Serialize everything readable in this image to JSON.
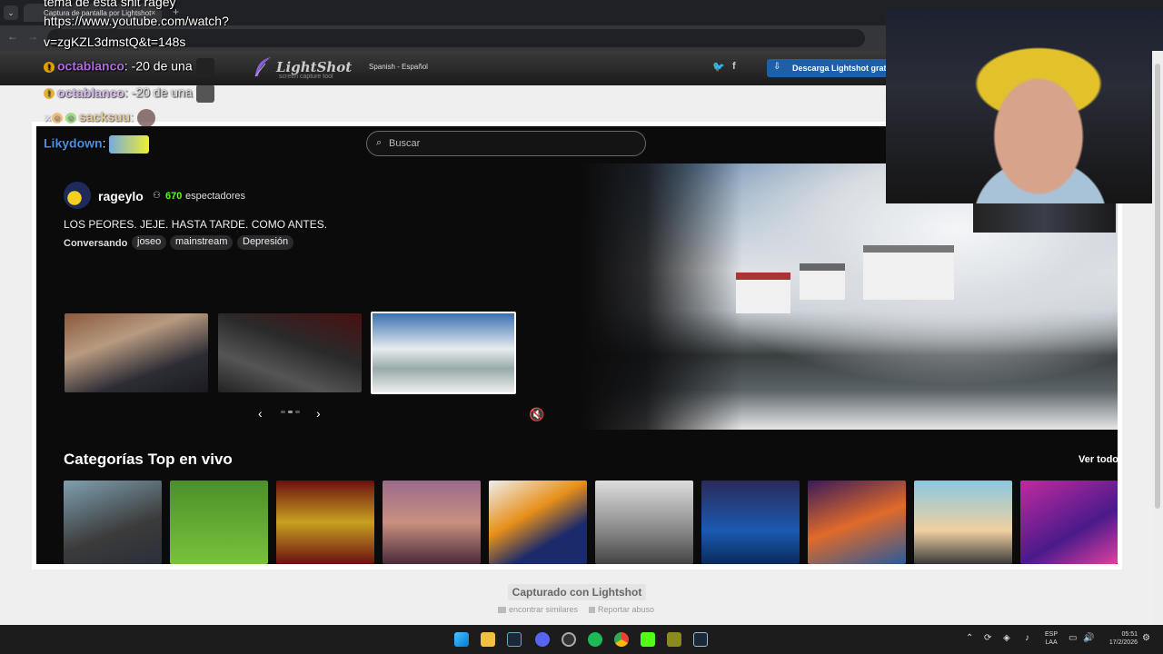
{
  "browser": {
    "tab_title": "Captura de pantalla por Lightshot",
    "tab_close": "×",
    "new_tab": "+"
  },
  "lightshot": {
    "logo": "LightShot",
    "subtitle": "screen capture tool",
    "language": "Spanish - Español",
    "download_button": "Descarga Lightshot grat",
    "twitter_icon": "twitter-icon",
    "facebook_icon": "facebook-icon"
  },
  "chat": {
    "line1": "tema de esta shit ragey",
    "line2": "https://www.youtube.com/watch?",
    "line3": "v=zgKZL3dmstQ&t=148s",
    "msg1_user": "octablanco",
    "msg1_text": ": -20 de una",
    "msg2_user": "octablanco",
    "msg2_text": ": -20 de una",
    "msg3_user": "sacksuu",
    "msg3_text": ":",
    "msg4_user": "Likydown",
    "msg4_text": ":"
  },
  "kick": {
    "search_placeholder": "Buscar",
    "streamer_name": "rageylo",
    "viewer_count": "670",
    "viewer_label": "espectadores",
    "stream_title": "LOS PEORES. JEJE. HASTA TARDE. COMO ANTES.",
    "category": "Conversando",
    "tags": [
      "joseo",
      "mainstream",
      "Depresión"
    ],
    "carousel_prev": "‹",
    "carousel_next": "›",
    "categories_title": "Categorías Top en vivo",
    "see_all": "Ver todo"
  },
  "footer": {
    "captured": "Capturado con Lightshot",
    "find_similar": "encontrar similares",
    "report_abuse": "Reportar abuso"
  },
  "taskbar": {
    "lang_top": "ESP",
    "lang_bottom": "LAA",
    "time": "05:51",
    "date": "17/2/2026"
  },
  "colors": {
    "kick_green": "#53fc18",
    "chat_username": "#b06be0",
    "lightshot_button": "#1f5fa5"
  }
}
